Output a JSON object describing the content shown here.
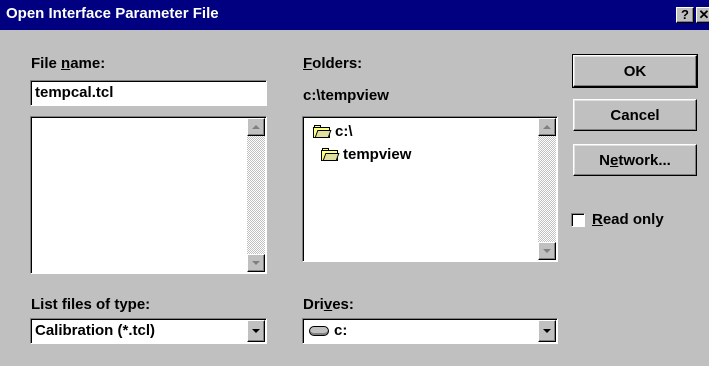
{
  "window": {
    "title": "Open Interface Parameter File",
    "help_label": "?",
    "close_label": "✕"
  },
  "filename": {
    "label_pre": "File ",
    "label_accel": "n",
    "label_post": "ame:",
    "value": "tempcal.tcl",
    "files": []
  },
  "folders": {
    "label_accel": "F",
    "label_post": "olders:",
    "current_path": "c:\\tempview",
    "items": [
      {
        "name": "c:\\"
      },
      {
        "name": "tempview"
      }
    ]
  },
  "filetype": {
    "label": "List files of type:",
    "value": "Calibration (*.tcl)"
  },
  "drives": {
    "label_pre": "Dri",
    "label_accel": "v",
    "label_post": "es:",
    "value": "c:"
  },
  "buttons": {
    "ok": "OK",
    "cancel": "Cancel",
    "network_pre": "N",
    "network_accel": "e",
    "network_post": "twork..."
  },
  "read_only": {
    "label_accel": "R",
    "label_post": "ead only",
    "checked": false
  }
}
